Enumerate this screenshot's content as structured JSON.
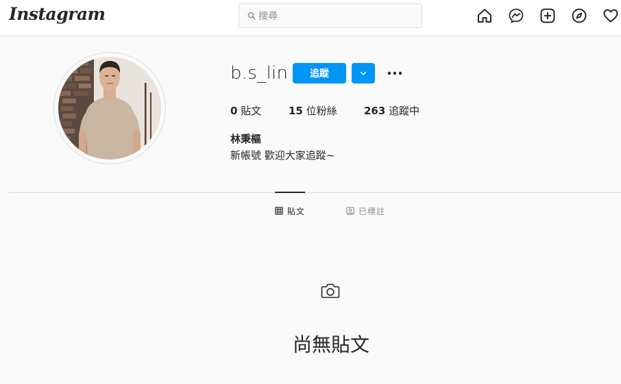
{
  "topbar": {
    "logo": "Instagram",
    "search_placeholder": "搜尋",
    "nav_icons": [
      "home-icon",
      "messenger-icon",
      "new-post-icon",
      "explore-icon",
      "activity-icon"
    ]
  },
  "profile": {
    "username": "b.s_lin",
    "follow_label": "追蹤",
    "stats": {
      "posts_count": "0",
      "posts_label": "貼文",
      "followers_count": "15",
      "followers_label": "位粉絲",
      "following_count": "263",
      "following_label": "追蹤中"
    },
    "full_name": "林秉樞",
    "bio": "新帳號 歡迎大家追蹤~"
  },
  "tabs": [
    {
      "label": "貼文",
      "active": true,
      "icon": "grid-icon"
    },
    {
      "label": "已標註",
      "active": false,
      "icon": "tagged-icon"
    }
  ],
  "empty_state": {
    "title": "尚無貼文",
    "icon": "camera-icon"
  },
  "colors": {
    "accent": "#0095f6",
    "background": "#fafafa",
    "text": "#262626",
    "muted": "#8e8e8e",
    "border": "#dbdbdb"
  }
}
